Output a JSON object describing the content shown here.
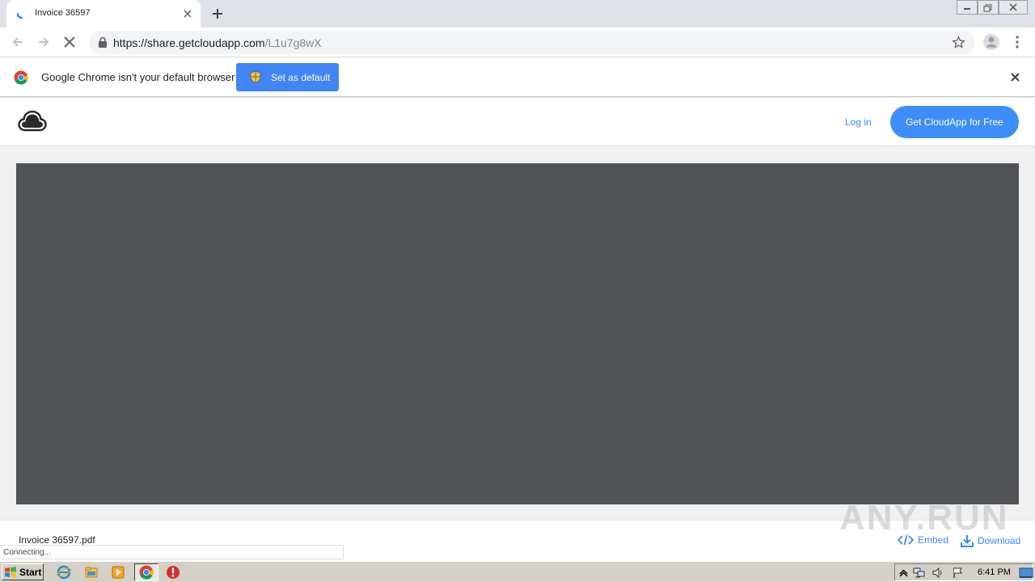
{
  "browser": {
    "tab_title": "Invoice 36597",
    "url_host": "https://share.getcloudapp.com",
    "url_path": "/L1u7g8wX"
  },
  "infobar": {
    "message": "Google Chrome isn't your default browser",
    "button_label": "Set as default"
  },
  "site": {
    "login_label": "Log in",
    "cta_label": "Get CloudApp for Free",
    "file_name": "Invoice 36597.pdf",
    "embed_label": "Embed",
    "download_label": "Download",
    "watermark": "ANY.RUN"
  },
  "status": {
    "text": "Connecting..."
  },
  "taskbar": {
    "start_label": "Start",
    "clock": "6:41 PM"
  },
  "colors": {
    "accent": "#3d8ef8",
    "viewer_bg": "#505457"
  }
}
